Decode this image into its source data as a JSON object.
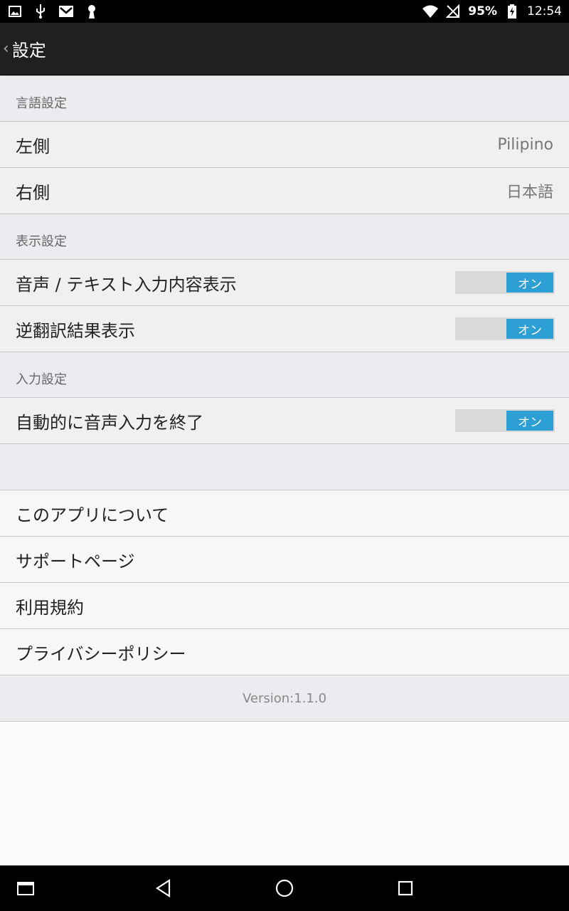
{
  "status": {
    "battery_pct": "95%",
    "time": "12:54"
  },
  "appbar": {
    "title": "設定"
  },
  "sections": {
    "language": {
      "header": "言語設定",
      "left_label": "左側",
      "left_value": "Pilipino",
      "right_label": "右側",
      "right_value": "日本語"
    },
    "display": {
      "header": "表示設定",
      "show_input_label": "音声 / テキスト入力内容表示",
      "show_input_toggle": "オン",
      "back_translation_label": "逆翻訳結果表示",
      "back_translation_toggle": "オン"
    },
    "input": {
      "header": "入力設定",
      "auto_end_label": "自動的に音声入力を終了",
      "auto_end_toggle": "オン"
    }
  },
  "links": {
    "about": "このアプリについて",
    "support": "サポートページ",
    "terms": "利用規約",
    "privacy": "プライバシーポリシー"
  },
  "version": "Version:1.1.0",
  "colors": {
    "accent": "#2e9fd5",
    "appbar": "#202020"
  }
}
